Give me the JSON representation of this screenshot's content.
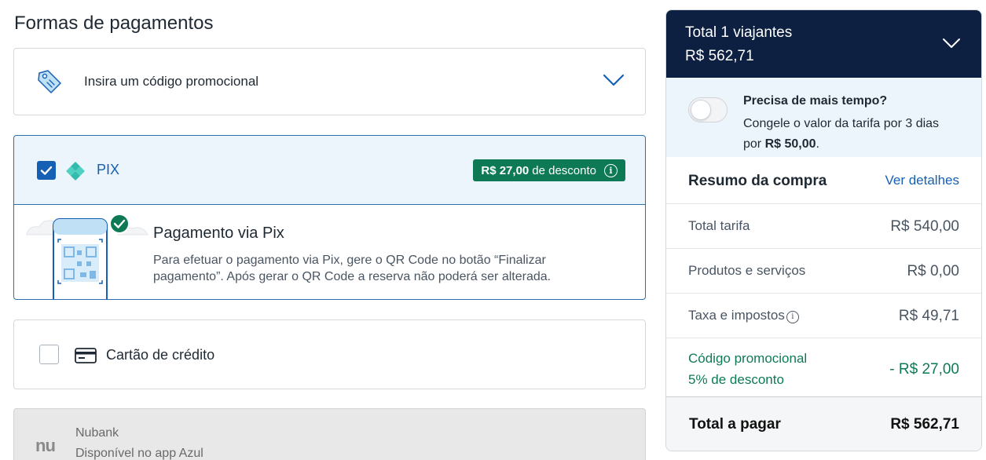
{
  "page_title": "Formas de pagamentos",
  "promo": {
    "label": "Insira um código promocional"
  },
  "pix": {
    "label": "PIX",
    "badge_amount": "R$ 27,00",
    "badge_text": "de desconto",
    "title": "Pagamento via Pix",
    "description": "Para efetuar o pagamento via Pix, gere o QR Code no botão “Finalizar pagamento”. Após gerar o QR Code a reserva não poderá ser alterada."
  },
  "credit_card": {
    "label": "Cartão de crédito"
  },
  "nubank": {
    "logo": "nu",
    "name": "Nubank",
    "subtitle": "Disponível no app Azul"
  },
  "summary": {
    "header_title": "Total 1 viajantes",
    "header_amount": "R$ 562,71",
    "freeze_question": "Precisa de mais tempo?",
    "freeze_text_prefix": "Congele o valor da tarifa por 3 dias por ",
    "freeze_price": "R$ 50,00",
    "freeze_text_suffix": ".",
    "freeze_toggle_on": false,
    "resumo_title": "Resumo da compra",
    "details_link": "Ver detalhes",
    "lines": [
      {
        "label": "Total tarifa",
        "value": "R$ 540,00"
      },
      {
        "label": "Produtos e serviços",
        "value": "R$ 0,00"
      },
      {
        "label": "Taxa e impostos",
        "value": "R$ 49,71"
      }
    ],
    "promo_line": {
      "label1": "Código promocional",
      "label2": "5% de desconto",
      "value": "- R$ 27,00"
    },
    "total_label": "Total a pagar",
    "total_value": "R$ 562,71"
  },
  "colors": {
    "navy": "#0d2041",
    "blue": "#1560b4",
    "green": "#0e7a55",
    "light_blue_bg": "#edf5fc"
  },
  "icons": [
    "tag-icon",
    "chevron-down-icon",
    "checkbox-checked-icon",
    "pix-logo-icon",
    "info-icon",
    "qr-phone-illustration",
    "credit-card-icon",
    "nubank-logo"
  ]
}
